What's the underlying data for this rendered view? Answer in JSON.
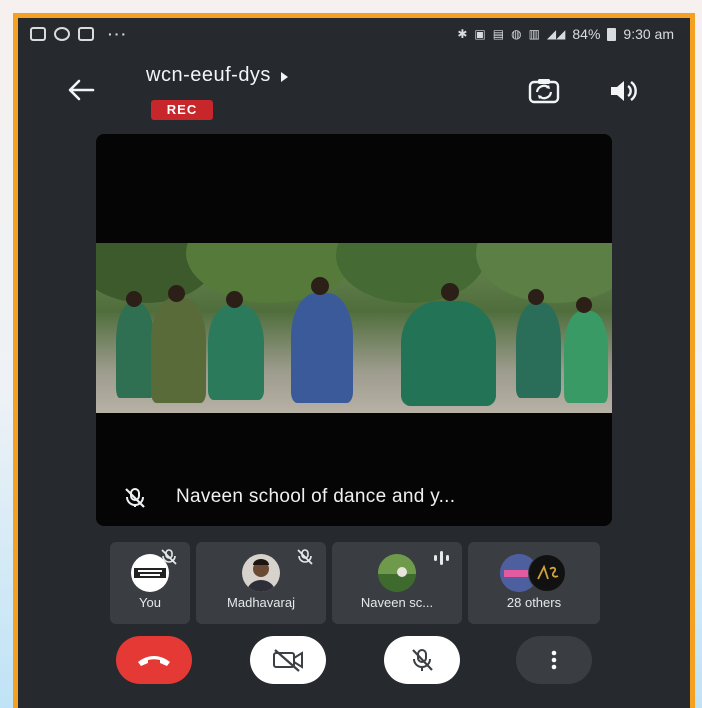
{
  "status_bar": {
    "battery": "84%",
    "time": "9:30 am",
    "overflow_glyph": "···"
  },
  "meeting": {
    "title": "wcn-eeuf-dys",
    "recording_badge": "REC"
  },
  "main_video": {
    "speaker_name": "Naveen school of dance and y..."
  },
  "participants": [
    {
      "label": "You",
      "muted": true
    },
    {
      "label": "Madhavaraj",
      "muted": true
    },
    {
      "label": "Naveen sc...",
      "speaking": true
    },
    {
      "label": "28 others"
    }
  ],
  "colors": {
    "accent_frame": "#f4a021",
    "app_background": "#262a2e",
    "rec_badge": "#c7262a",
    "end_call": "#e53935",
    "tile": "#3a3e42"
  },
  "icons": {
    "back": "arrow-left-icon",
    "switch_camera": "switch-camera-icon",
    "speaker": "speaker-icon",
    "end_call": "phone-hangup-icon",
    "camera_off": "camera-off-icon",
    "mic_off": "mic-off-icon",
    "more": "more-vertical-icon"
  }
}
